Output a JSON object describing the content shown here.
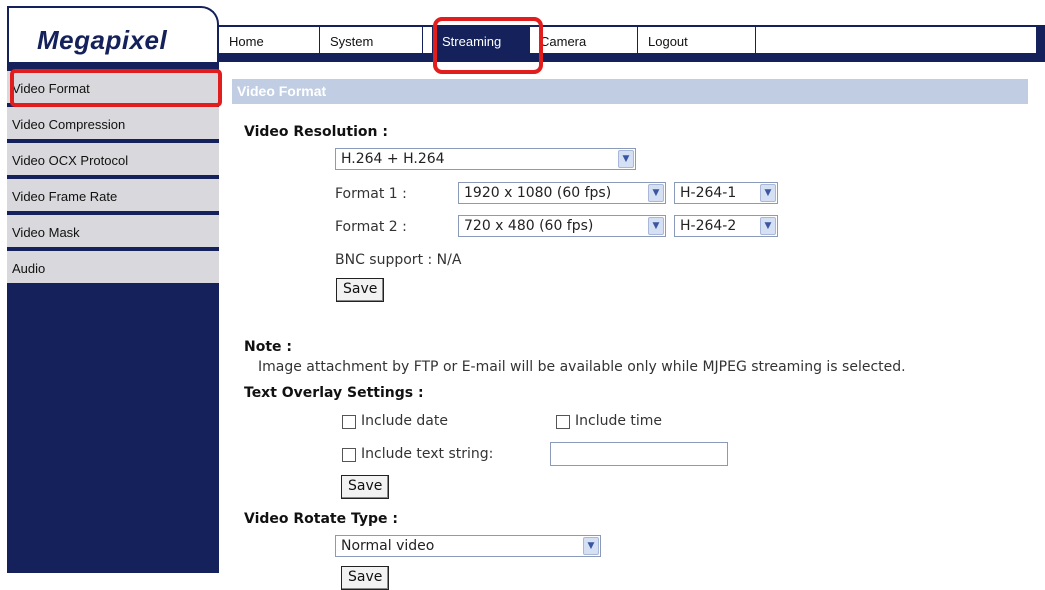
{
  "app": {
    "logo": "Megapixel"
  },
  "nav": {
    "tabs": [
      {
        "label": "Home"
      },
      {
        "label": "System"
      },
      {
        "label": "Streaming"
      },
      {
        "label": "Camera"
      },
      {
        "label": "Logout"
      }
    ],
    "active": "Streaming"
  },
  "sidebar": {
    "items": [
      {
        "label": "Video Format"
      },
      {
        "label": "Video Compression"
      },
      {
        "label": "Video OCX Protocol"
      },
      {
        "label": "Video Frame Rate"
      },
      {
        "label": "Video Mask"
      },
      {
        "label": "Audio"
      }
    ],
    "active": "Video Format"
  },
  "main": {
    "section_title": "Video Format",
    "video_resolution": {
      "heading": "Video Resolution :",
      "mode": "H.264 + H.264",
      "format1_label": "Format 1 :",
      "format1_resolution": "1920 x 1080 (60 fps)",
      "format1_codec": "H-264-1",
      "format2_label": "Format 2 :",
      "format2_resolution": "720 x 480 (60 fps)",
      "format2_codec": "H-264-2",
      "bnc_support": "BNC support : N/A",
      "save_label": "Save"
    },
    "note": {
      "heading": "Note :",
      "text": "Image attachment by FTP or E-mail will be available only while MJPEG streaming is selected."
    },
    "text_overlay": {
      "heading": "Text Overlay Settings :",
      "include_date": "Include date",
      "include_time": "Include time",
      "include_text_string": "Include text string:",
      "text_string_value": "",
      "save_label": "Save"
    },
    "video_rotate": {
      "heading": "Video Rotate Type :",
      "value": "Normal video",
      "save_label": "Save"
    }
  },
  "colors": {
    "navy": "#14215a",
    "section_bar": "#c1cde3",
    "sidebar_item": "#d9d9dd",
    "highlight_red": "#e21d1d"
  }
}
